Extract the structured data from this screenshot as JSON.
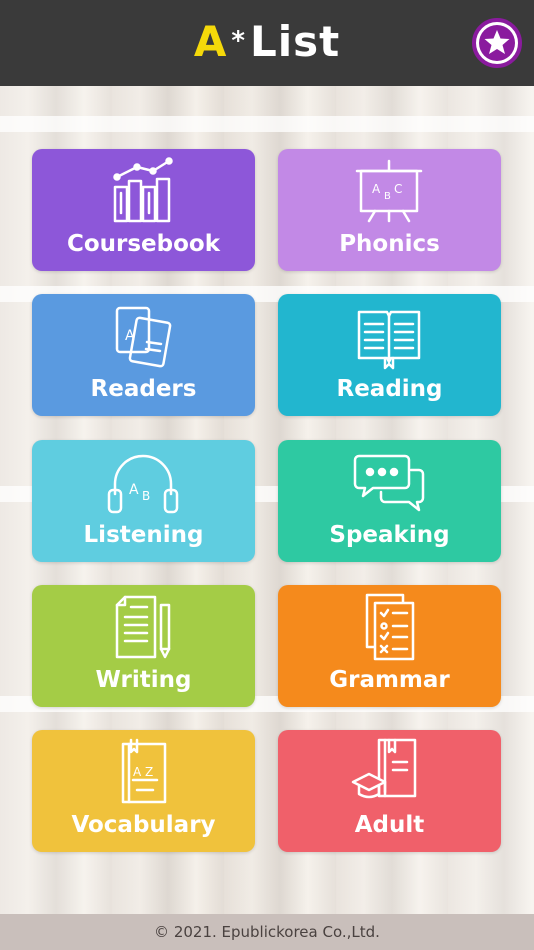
{
  "header": {
    "logo_a": "A",
    "logo_star": "*",
    "logo_list": "List"
  },
  "menu": {
    "coursebook": {
      "label": "Coursebook",
      "color": "#8d57d9",
      "icon": "books-chart-icon"
    },
    "phonics": {
      "label": "Phonics",
      "color": "#c289e6",
      "icon": "abc-board-icon"
    },
    "readers": {
      "label": "Readers",
      "color": "#5a9ae0",
      "icon": "cards-icon"
    },
    "reading": {
      "label": "Reading",
      "color": "#22b6cf",
      "icon": "open-book-icon"
    },
    "listening": {
      "label": "Listening",
      "color": "#5fcde0",
      "icon": "headphones-icon"
    },
    "speaking": {
      "label": "Speaking",
      "color": "#2ec9a2",
      "icon": "chat-bubbles-icon"
    },
    "writing": {
      "label": "Writing",
      "color": "#a4cc46",
      "icon": "paper-pencil-icon"
    },
    "grammar": {
      "label": "Grammar",
      "color": "#f58a1c",
      "icon": "checklist-icon"
    },
    "vocabulary": {
      "label": "Vocabulary",
      "color": "#f0c23c",
      "icon": "dictionary-icon"
    },
    "adult": {
      "label": "Adult",
      "color": "#f0606a",
      "icon": "graduation-book-icon"
    }
  },
  "footer": {
    "copyright": "© 2021. Epublickorea Co.,Ltd."
  },
  "colors": {
    "header_bg": "#3a3a3a",
    "logo_accent": "#f5d90a",
    "favorite_ring": "#8a1b9e",
    "footer_bg": "#c9bfbb"
  }
}
